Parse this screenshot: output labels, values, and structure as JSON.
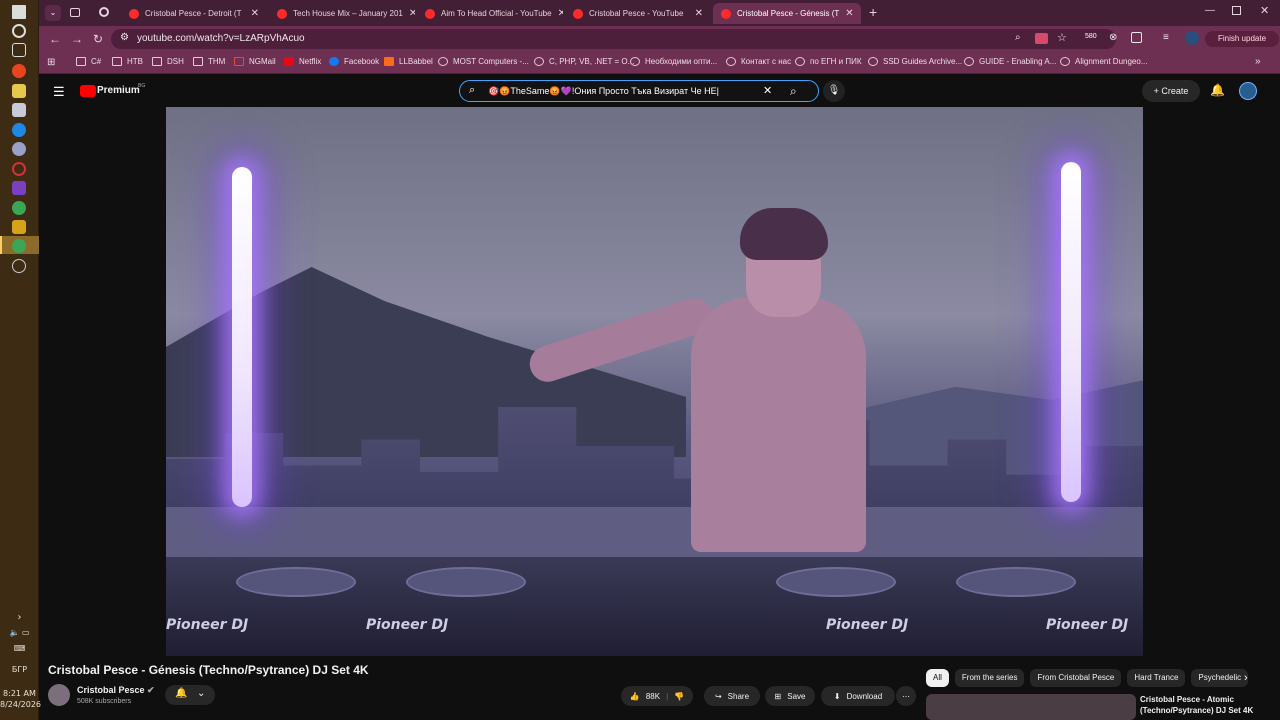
{
  "taskbar": {
    "time": "8:21 AM",
    "date": "8/24/2026",
    "lang": "БГР"
  },
  "tabs": [
    {
      "title": "Cristobal Pesce - Detroit (T"
    },
    {
      "title": "Tech House Mix – January 201"
    },
    {
      "title": "Aim To Head Official - YouTube"
    },
    {
      "title": "Cristobal Pesce - YouTube"
    },
    {
      "title": "Cristobal Pesce - Génesis (T"
    }
  ],
  "address": {
    "url": "youtube.com/watch?v=LzARpVhAcuo",
    "finish_update": "Finish update",
    "badge": "580"
  },
  "bookmarks": [
    "C#",
    "HTB",
    "DSH",
    "THM",
    "NGMail",
    "Netflix",
    "Facebook",
    "LLBabbel",
    "MOST Computers -...",
    "C, PHP, VB, .NET = О...",
    "Необходими опти...",
    "Контакт с нас",
    "по ЕГН и ПИК",
    "SSD Guides Archive...",
    "GUIDE - Enabling A...",
    "Alignment Dungeo..."
  ],
  "yt": {
    "logo": "Premium",
    "logo_sup": "BG",
    "search_value": "🎯😡TheSame😡💜!Ония Просто Тъка Визират Че НЕ|",
    "create": "Create"
  },
  "video": {
    "title": "Cristobal Pesce - Génesis (Techno/Psytrance) DJ Set 4K",
    "deck_brand": "Pioneer DJ",
    "channel": "Cristobal Pesce",
    "subscribers": "508K subscribers",
    "likes": "88K",
    "share": "Share",
    "save": "Save",
    "download": "Download"
  },
  "chips": [
    "All",
    "From the series",
    "From Cristobal Pesce",
    "Hard Trance",
    "Psychedelic"
  ],
  "recommendation": {
    "title": "Cristobal Pesce - Atomic (Techno/Psytrance) DJ Set 4K"
  },
  "colors": {
    "tab_bar": "#421f35",
    "toolbar": "#6d2f52",
    "yt_bg": "#0f0f0f",
    "search_focus": "#3ea6ff"
  }
}
